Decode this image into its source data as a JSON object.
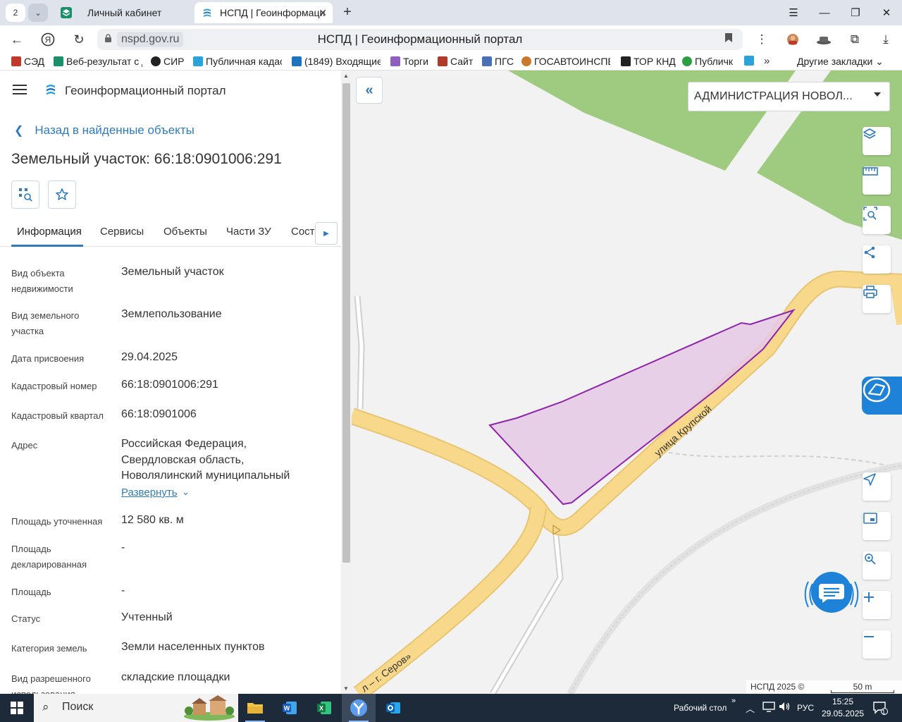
{
  "browser": {
    "tab_count": "2",
    "tabs": [
      {
        "title": "Личный кабинет"
      },
      {
        "title": "НСПД | Геоинформаци"
      }
    ],
    "url_host": "nspd.gov.ru",
    "page_title": "НСПД | Геоинформационный портал",
    "bookmarks": [
      "СЭД",
      "Веб-результат с д",
      "СИР",
      "Публичная кадас",
      "(1849) Входящие",
      "Торги",
      "Сайт",
      "ПГС",
      "ГОСАВТОИНСПЕ",
      "ТОР КНД",
      "Публичк"
    ],
    "other_bookmarks": "Другие закладки"
  },
  "panel": {
    "portal_name": "Геоинформационный портал",
    "back_label": "Назад в найденные объекты",
    "title": "Земельный участок: 66:18:0901006:291",
    "tabs": [
      "Информация",
      "Сервисы",
      "Объекты",
      "Части ЗУ",
      "Соста"
    ],
    "rows": [
      {
        "label": "Вид объекта недвижимости",
        "value": "Земельный участок"
      },
      {
        "label": "Вид земельного участка",
        "value": "Землепользование"
      },
      {
        "label": "Дата присвоения",
        "value": "29.04.2025"
      },
      {
        "label": "Кадастровый номер",
        "value": "66:18:0901006:291"
      },
      {
        "label": "Кадастровый квартал",
        "value": "66:18:0901006"
      },
      {
        "label": "Адрес",
        "value": "Российская Федерация, Свердловская область, Новолялинский муниципальный"
      },
      {
        "label": "Площадь уточненная",
        "value": "12 580 кв. м"
      },
      {
        "label": "Площадь декларированная",
        "value": "-"
      },
      {
        "label": "Площадь",
        "value": "-"
      },
      {
        "label": "Статус",
        "value": "Учтенный"
      },
      {
        "label": "Категория земель",
        "value": "Земли населенных пунктов"
      },
      {
        "label": "Вид разрешенного использования",
        "value": "складские площадки"
      }
    ],
    "expand_label": "Развернуть"
  },
  "map": {
    "region": "АДМИНИСТРАЦИЯ НОВОЛ...",
    "street_label": "улица Крупской",
    "road_label": "л – г. Серов»",
    "attribution": "НСПД 2025 ©",
    "scale": "50 m",
    "colors": {
      "parcel_fill": "#e6c9e6",
      "parcel_stroke": "#8e24aa",
      "road": "#f8d98c",
      "forest": "#9fcb80",
      "accent": "#2f7bbd"
    }
  },
  "taskbar": {
    "search_placeholder": "Поиск",
    "desktop_label": "Рабочий стол",
    "lang": "РУС",
    "time": "15:25",
    "date": "29.05.2025",
    "notification_count": "1"
  }
}
